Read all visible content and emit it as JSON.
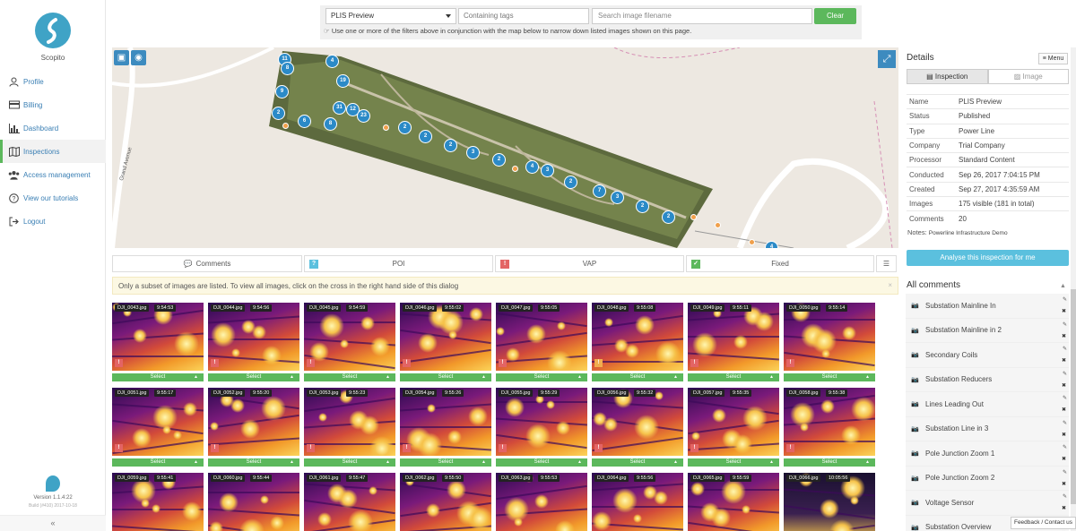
{
  "app": {
    "name": "Scopito",
    "version": "Version 1.1.4:22",
    "build": "Build (#410) 2017-10-18"
  },
  "nav": [
    {
      "label": "Profile",
      "icon": "user-icon"
    },
    {
      "label": "Billing",
      "icon": "credit-card-icon"
    },
    {
      "label": "Dashboard",
      "icon": "bar-chart-icon"
    },
    {
      "label": "Inspections",
      "icon": "map-icon"
    },
    {
      "label": "Access management",
      "icon": "users-icon"
    },
    {
      "label": "View our tutorials",
      "icon": "question-icon"
    },
    {
      "label": "Logout",
      "icon": "logout-icon"
    }
  ],
  "filters": {
    "inspection_select": "PLIS Preview",
    "tags_placeholder": "Containing tags",
    "search_placeholder": "Search image filename",
    "clear_label": "Clear",
    "hint": "Use one or more of the filters above in conjunction with the map below to narrow down listed images shown on this page."
  },
  "map": {
    "street_label": "Grand Avenue",
    "markers": [
      "11",
      "4",
      "8",
      "19",
      "9",
      "31",
      "12",
      "23",
      "2",
      "6",
      "8",
      "2",
      "2",
      "2",
      "3",
      "2",
      "4",
      "3",
      "2",
      "7",
      "3",
      "2",
      "2",
      "4"
    ]
  },
  "tabs": [
    {
      "label": "Comments",
      "icon": "comment-icon"
    },
    {
      "label": "POI",
      "icon": "poi-icon"
    },
    {
      "label": "VAP",
      "icon": "vap-icon"
    },
    {
      "label": "Fixed",
      "icon": "check-icon"
    }
  ],
  "notice": "Only a subset of images are listed. To view all images, click on the cross in the right hand side of this dialog",
  "select_label": "Select",
  "images": [
    {
      "file": "DJI_0043.jpg",
      "time": "9:54:53"
    },
    {
      "file": "DJI_0044.jpg",
      "time": "9:54:56"
    },
    {
      "file": "DJI_0045.jpg",
      "time": "9:54:59"
    },
    {
      "file": "DJI_0046.jpg",
      "time": "9:55:02"
    },
    {
      "file": "DJI_0047.jpg",
      "time": "9:55:05"
    },
    {
      "file": "DJI_0048.jpg",
      "time": "9:55:08"
    },
    {
      "file": "DJI_0049.jpg",
      "time": "9:55:11"
    },
    {
      "file": "DJI_0050.jpg",
      "time": "9:55:14"
    },
    {
      "file": "DJI_0051.jpg",
      "time": "9:55:17"
    },
    {
      "file": "DJI_0052.jpg",
      "time": "9:55:20"
    },
    {
      "file": "DJI_0053.jpg",
      "time": "9:55:23"
    },
    {
      "file": "DJI_0054.jpg",
      "time": "9:55:26"
    },
    {
      "file": "DJI_0055.jpg",
      "time": "9:55:29"
    },
    {
      "file": "DJI_0056.jpg",
      "time": "9:55:32"
    },
    {
      "file": "DJI_0057.jpg",
      "time": "9:55:35"
    },
    {
      "file": "DJI_0058.jpg",
      "time": "9:55:38"
    },
    {
      "file": "DJI_0059.jpg",
      "time": "9:55:41"
    },
    {
      "file": "DJI_0060.jpg",
      "time": "9:55:44"
    },
    {
      "file": "DJI_0061.jpg",
      "time": "9:55:47"
    },
    {
      "file": "DJI_0062.jpg",
      "time": "9:55:50"
    },
    {
      "file": "DJI_0063.jpg",
      "time": "9:55:53"
    },
    {
      "file": "DJI_0064.jpg",
      "time": "9:55:56"
    },
    {
      "file": "DJI_0065.jpg",
      "time": "9:55:59"
    },
    {
      "file": "DJI_0066.jpg",
      "time": "10:05:56"
    }
  ],
  "details": {
    "title": "Details",
    "menu_label": "Menu",
    "tab_inspection": "Inspection",
    "tab_image": "Image",
    "rows": [
      {
        "k": "Name",
        "v": "PLIS Preview"
      },
      {
        "k": "Status",
        "v": "Published"
      },
      {
        "k": "Type",
        "v": "Power Line"
      },
      {
        "k": "Company",
        "v": "Trial Company"
      },
      {
        "k": "Processor",
        "v": "Standard Content"
      },
      {
        "k": "Conducted",
        "v": "Sep 26, 2017 7:04:15 PM"
      },
      {
        "k": "Created",
        "v": "Sep 27, 2017 4:35:59 AM"
      },
      {
        "k": "Images",
        "v": "175 visible (181 in total)"
      },
      {
        "k": "Comments",
        "v": "20"
      }
    ],
    "notes_label": "Notes:",
    "notes_value": "Powerline Infrastructure Demo",
    "analyse_label": "Analyse this inspection for me"
  },
  "comments": {
    "title": "All comments",
    "items": [
      "Substation Mainline In",
      "Substation Mainline in 2",
      "Secondary Coils",
      "Substation Reducers",
      "Lines Leading Out",
      "Substation Line in 3",
      "Pole Junction Zoom 1",
      "Pole Junction Zoom 2",
      "Voltage Sensor",
      "Substation Overview"
    ]
  },
  "feedback_label": "Feedback / Contact us",
  "colors": {
    "accent": "#3d8bbf",
    "green": "#5cb85c",
    "info": "#5bc0de",
    "badge_red": "#e36464"
  }
}
